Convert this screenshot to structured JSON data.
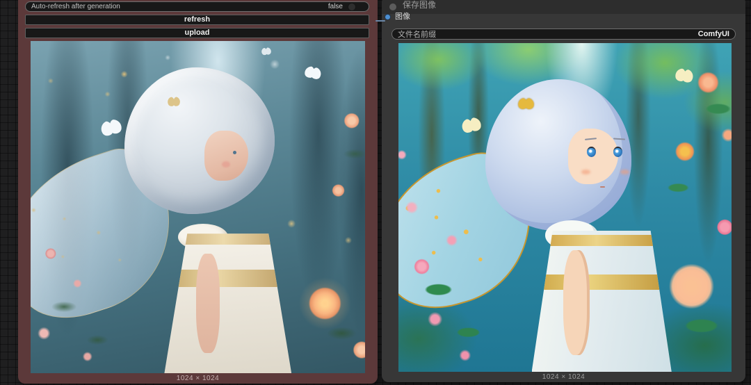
{
  "canvas": {
    "type": "node-graph-canvas"
  },
  "colors": {
    "left_node": "#5c393a",
    "right_node": "#373737",
    "socket": "#4d8fd1",
    "link": "#6a87a8"
  },
  "left_node": {
    "widgets": {
      "auto_refresh": {
        "label": "Auto-refresh after generation",
        "value": "false"
      },
      "refresh_button_label": "refresh",
      "upload_button_label": "upload"
    },
    "preview": {
      "size_label": "1024 × 1024",
      "alt": "Photorealistic fairy girl with silver curly hair, translucent gold-trimmed butterfly wings and a white dress, in a misty blue forest with glowing peach roses and white butterflies"
    }
  },
  "right_node": {
    "title": "保存图像",
    "input_label": "图像",
    "widgets": {
      "filename_prefix": {
        "label": "文件名前缀",
        "value": "ComfyUI"
      }
    },
    "preview": {
      "size_label": "1024 × 1024",
      "alt": "Anime-style fairy girl with wavy light-blue hair, gold butterfly hairpin, blue and gold butterfly wings and a white dress with gold trim, among pink and orange roses in a sunlit forest"
    }
  }
}
